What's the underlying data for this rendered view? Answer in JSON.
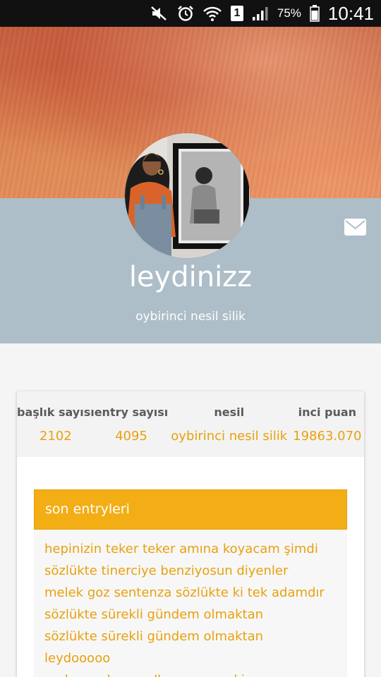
{
  "status_bar": {
    "battery_percent": "75%",
    "time": "10:41",
    "sim_number": "1",
    "icons": [
      "mute-icon",
      "alarm-icon",
      "wifi-icon",
      "sim-icon",
      "signal-icon",
      "battery-icon"
    ]
  },
  "profile": {
    "username": "leydinizz",
    "subtitle": "oybirinci nesil silik",
    "cover_icon": "cover-image",
    "avatar_icon": "avatar-photo",
    "mail_icon": "mail-icon"
  },
  "stats": [
    {
      "label": "başlık sayısı",
      "value": "2102"
    },
    {
      "label": "entry sayısı",
      "value": "4095"
    },
    {
      "label": "nesil",
      "value": "oybirinci nesil silik"
    },
    {
      "label": "inci puan",
      "value": "19863.070"
    }
  ],
  "recent_entries": {
    "title": "son entryleri",
    "items": [
      "hepinizin teker teker amına koyacam şimdi",
      "sözlükte tinerciye benziyosun diyenler",
      "melek goz sentenza sözlükte ki tek adamdır",
      "sözlükte sürekli gündem olmaktan",
      "sözlükte sürekli gündem olmaktan",
      "leydooooo",
      "malum şahıs modlara saçe çekiyor"
    ]
  },
  "colors": {
    "accent": "#f3ae15",
    "accent_text": "#e8a10e",
    "header_band": "#adbec8",
    "status_bar": "#111111"
  }
}
